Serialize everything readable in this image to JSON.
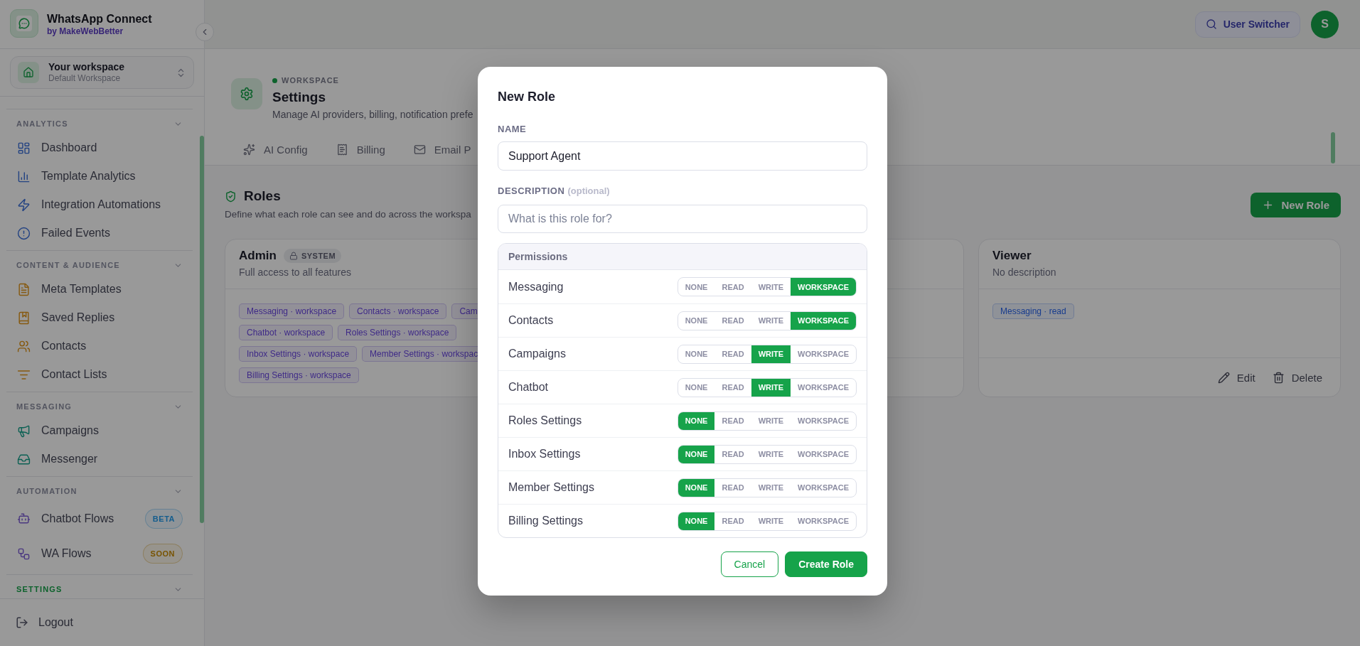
{
  "sidebar": {
    "brand": {
      "title": "WhatsApp Connect",
      "subtitle": "by MakeWebBetter"
    },
    "workspace": {
      "name": "Your workspace",
      "detail": "Default Workspace"
    },
    "sections": [
      {
        "title": "ANALYTICS",
        "selected": false,
        "items": [
          {
            "label": "Dashboard"
          },
          {
            "label": "Template Analytics"
          },
          {
            "label": "Integration Automations"
          },
          {
            "label": "Failed Events"
          }
        ]
      },
      {
        "title": "CONTENT & AUDIENCE",
        "selected": false,
        "items": [
          {
            "label": "Meta Templates"
          },
          {
            "label": "Saved Replies"
          },
          {
            "label": "Contacts"
          },
          {
            "label": "Contact Lists"
          }
        ]
      },
      {
        "title": "MESSAGING",
        "selected": false,
        "items": [
          {
            "label": "Campaigns"
          },
          {
            "label": "Messenger"
          }
        ]
      },
      {
        "title": "AUTOMATION",
        "selected": false,
        "items": [
          {
            "label": "Chatbot Flows",
            "badge": {
              "text": "BETA",
              "kind": "beta"
            }
          },
          {
            "label": "WA Flows",
            "badge": {
              "text": "SOON",
              "kind": "soon"
            }
          }
        ]
      },
      {
        "title": "SETTINGS",
        "selected": true
      }
    ],
    "logout": "Logout"
  },
  "topbar": {
    "user_switcher": "User Switcher",
    "avatar": "S"
  },
  "page": {
    "eyebrow": "WORKSPACE",
    "title": "Settings",
    "description": "Manage AI providers, billing, notification prefe"
  },
  "tabs": [
    {
      "label": "AI Config",
      "selected": false
    },
    {
      "label": "Billing",
      "selected": false
    },
    {
      "label": "Email P",
      "selected": false
    }
  ],
  "roles": {
    "title": "Roles",
    "description": "Define what each role can see and do across the workspa",
    "new_role_button": "New Role",
    "cards": [
      {
        "kind": "system",
        "name": "Admin",
        "badge": "SYSTEM",
        "description": "Full access to all features",
        "permissions": [
          {
            "label": "Messaging · workspace",
            "kind": "workspace"
          },
          {
            "label": "Contacts · workspace",
            "kind": "workspace"
          },
          {
            "label": "Cam",
            "kind": "workspace"
          },
          {
            "label": "Chatbot · workspace",
            "kind": "workspace"
          },
          {
            "label": "Roles Settings · workspace",
            "kind": "workspace"
          },
          {
            "label": "Inbox Settings · workspace",
            "kind": "workspace"
          },
          {
            "label": "Member Settings · workspac",
            "kind": "workspace"
          },
          {
            "label": "Billing Settings · workspace",
            "kind": "workspace"
          }
        ]
      },
      {
        "kind": "covered"
      },
      {
        "kind": "custom",
        "name": "Viewer",
        "description": "No description",
        "permissions": [
          {
            "label": "Messaging · read",
            "kind": "read"
          }
        ],
        "actions": [
          "Edit",
          "Delete"
        ]
      }
    ]
  },
  "modal": {
    "title": "New Role",
    "name_field": {
      "label": "NAME",
      "value": "Support Agent"
    },
    "description_field": {
      "label": "DESCRIPTION",
      "hint": "(optional)",
      "placeholder": "What is this role for?"
    },
    "permissions_heading": "Permissions",
    "permissions": [
      {
        "name": "Messaging",
        "options": [
          {
            "label": "NONE",
            "selected": false
          },
          {
            "label": "READ",
            "selected": false
          },
          {
            "label": "WRITE",
            "selected": false
          },
          {
            "label": "WORKSPACE",
            "selected": true
          }
        ]
      },
      {
        "name": "Contacts",
        "options": [
          {
            "label": "NONE",
            "selected": false
          },
          {
            "label": "READ",
            "selected": false
          },
          {
            "label": "WRITE",
            "selected": false
          },
          {
            "label": "WORKSPACE",
            "selected": true
          }
        ]
      },
      {
        "name": "Campaigns",
        "options": [
          {
            "label": "NONE",
            "selected": false
          },
          {
            "label": "READ",
            "selected": false
          },
          {
            "label": "WRITE",
            "selected": true
          },
          {
            "label": "WORKSPACE",
            "selected": false
          }
        ]
      },
      {
        "name": "Chatbot",
        "options": [
          {
            "label": "NONE",
            "selected": false
          },
          {
            "label": "READ",
            "selected": false
          },
          {
            "label": "WRITE",
            "selected": true
          },
          {
            "label": "WORKSPACE",
            "selected": false
          }
        ]
      },
      {
        "name": "Roles Settings",
        "options": [
          {
            "label": "NONE",
            "selected": true
          },
          {
            "label": "READ",
            "selected": false
          },
          {
            "label": "WRITE",
            "selected": false
          },
          {
            "label": "WORKSPACE",
            "selected": false
          }
        ]
      },
      {
        "name": "Inbox Settings",
        "options": [
          {
            "label": "NONE",
            "selected": true
          },
          {
            "label": "READ",
            "selected": false
          },
          {
            "label": "WRITE",
            "selected": false
          },
          {
            "label": "WORKSPACE",
            "selected": false
          }
        ]
      },
      {
        "name": "Member Settings",
        "options": [
          {
            "label": "NONE",
            "selected": true
          },
          {
            "label": "READ",
            "selected": false
          },
          {
            "label": "WRITE",
            "selected": false
          },
          {
            "label": "WORKSPACE",
            "selected": false
          }
        ]
      },
      {
        "name": "Billing Settings",
        "options": [
          {
            "label": "NONE",
            "selected": true
          },
          {
            "label": "READ",
            "selected": false
          },
          {
            "label": "WRITE",
            "selected": false
          },
          {
            "label": "WORKSPACE",
            "selected": false
          }
        ]
      }
    ],
    "buttons": [
      {
        "label": "Cancel",
        "kind": "secondary"
      },
      {
        "label": "Create Role",
        "kind": "primary"
      }
    ]
  }
}
